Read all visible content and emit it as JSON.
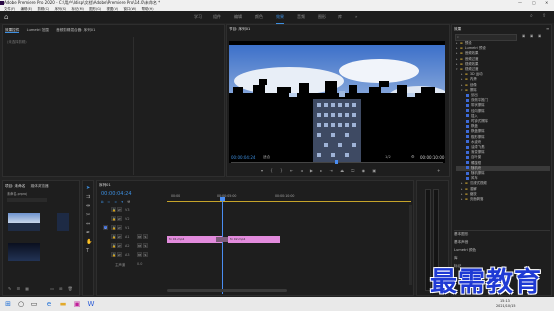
{
  "window": {
    "title": "Adobe Premiere Pro 2020 - C:\\用户\\Idisp\\文档\\Adobe\\Premiere Pro\\14.0\\未命名 *",
    "controls": [
      "—",
      "▢",
      "✕"
    ]
  },
  "menu": [
    "文件(F)",
    "编辑(E)",
    "剪辑(C)",
    "序列(S)",
    "标记(M)",
    "图形(G)",
    "视图(V)",
    "窗口(W)",
    "帮助(H)"
  ],
  "workspaces": {
    "items": [
      "学习",
      "组件",
      "编辑",
      "颜色",
      "效果",
      "音频",
      "图形",
      "库"
    ],
    "active_index": 4
  },
  "left_panel": {
    "tabs": [
      "效果控件",
      "Lumetri 范围",
      "音频剪辑混合器: 序列01"
    ],
    "empty_text": "(未选择剪辑)"
  },
  "program_monitor": {
    "title": "节目: 序列01",
    "timecode_left": "00:00:04:24",
    "fit": "适合",
    "ratio": "1/2",
    "timecode_right": "00:00:10:00"
  },
  "effects_panel": {
    "title": "效果",
    "search_placeholder": "",
    "items": [
      {
        "label": "预设",
        "type": "folder",
        "indent": 0
      },
      {
        "label": "Lumetri 预设",
        "type": "folder",
        "indent": 0
      },
      {
        "label": "音频效果",
        "type": "folder",
        "indent": 0
      },
      {
        "label": "音频过渡",
        "type": "folder",
        "indent": 0
      },
      {
        "label": "视频效果",
        "type": "folder",
        "indent": 0
      },
      {
        "label": "视频过渡",
        "type": "folder-open",
        "indent": 0
      },
      {
        "label": "3D 运动",
        "type": "folder",
        "indent": 1
      },
      {
        "label": "内滑",
        "type": "folder",
        "indent": 1
      },
      {
        "label": "划像",
        "type": "folder",
        "indent": 1
      },
      {
        "label": "擦除",
        "type": "folder-open",
        "indent": 1
      },
      {
        "label": "划出",
        "type": "fx",
        "indent": 2
      },
      {
        "label": "双侧平推门",
        "type": "fx",
        "indent": 2
      },
      {
        "label": "带状擦除",
        "type": "fx",
        "indent": 2
      },
      {
        "label": "径向擦除",
        "type": "fx",
        "indent": 2
      },
      {
        "label": "插入",
        "type": "fx",
        "indent": 2
      },
      {
        "label": "时钟式擦除",
        "type": "fx",
        "indent": 2
      },
      {
        "label": "棋盘",
        "type": "fx",
        "indent": 2
      },
      {
        "label": "棋盘擦除",
        "type": "fx",
        "indent": 2
      },
      {
        "label": "楔形擦除",
        "type": "fx",
        "indent": 2
      },
      {
        "label": "水波块",
        "type": "fx",
        "indent": 2
      },
      {
        "label": "油漆飞溅",
        "type": "fx",
        "indent": 2
      },
      {
        "label": "渐变擦除",
        "type": "fx",
        "indent": 2
      },
      {
        "label": "百叶窗",
        "type": "fx",
        "indent": 2
      },
      {
        "label": "螺旋框",
        "type": "fx",
        "indent": 2
      },
      {
        "label": "随机块",
        "type": "fx",
        "indent": 2,
        "selected": true
      },
      {
        "label": "随机擦除",
        "type": "fx",
        "indent": 2
      },
      {
        "label": "风车",
        "type": "fx",
        "indent": 2
      },
      {
        "label": "沉浸式视频",
        "type": "folder",
        "indent": 1
      },
      {
        "label": "溶解",
        "type": "folder",
        "indent": 1
      },
      {
        "label": "缩放",
        "type": "folder",
        "indent": 1
      },
      {
        "label": "页面剥落",
        "type": "folder",
        "indent": 1
      }
    ],
    "bottom_sections": [
      "基本图形",
      "基本声音",
      "Lumetri 颜色",
      "库",
      "标记"
    ]
  },
  "project_panel": {
    "tabs": [
      "项目: 未命名",
      "媒体浏览器"
    ],
    "project_name": "未命名.prproj",
    "search_placeholder": ""
  },
  "timeline": {
    "title": "序列01",
    "timecode": "00:00:04:24",
    "ruler": [
      "00:00",
      "00:00:05:00",
      "00:00:10:00"
    ],
    "tracks": [
      "V3",
      "V2",
      "V1",
      "A1",
      "A2",
      "A3"
    ],
    "master_label": "主声道",
    "master_value": "0.0",
    "clip1": "fx 01.mp4",
    "clip2": "fx 02.mp4"
  },
  "watermark": "最需教育",
  "taskbar": {
    "time": "15:13",
    "date": "2021/10/15"
  },
  "colors": {
    "accent": "#3d8fe0",
    "clip": "#e28bdc",
    "playhead": "#4a8df2",
    "selection": "#3d3d3d"
  }
}
